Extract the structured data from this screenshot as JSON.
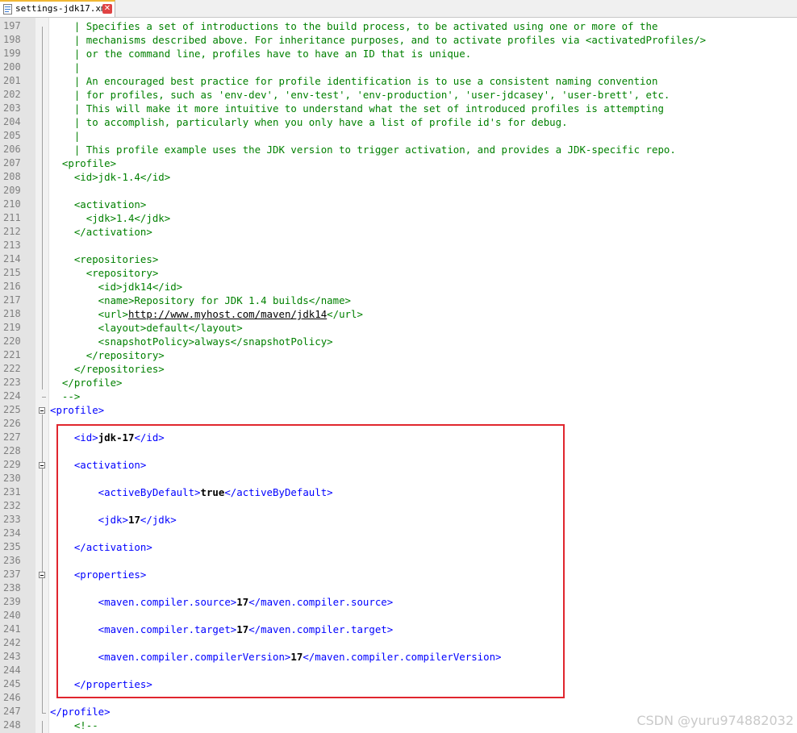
{
  "tab": {
    "label": "settings-jdk17.xml"
  },
  "watermark": "CSDN @yuru974882032",
  "colors": {
    "comment": "#008000",
    "tag": "#0000ff",
    "text": "#000000",
    "highlight": "#e0262e"
  },
  "lines": [
    {
      "n": "197",
      "segs": [
        [
          "c",
          "    | Specifies a set of introductions to the build process, to be activated using one or more of the"
        ]
      ]
    },
    {
      "n": "198",
      "segs": [
        [
          "c",
          "    | mechanisms described above. For inheritance purposes, and to activate profiles via <activatedProfiles/>"
        ]
      ]
    },
    {
      "n": "199",
      "segs": [
        [
          "c",
          "    | or the command line, profiles have to have an ID that is unique."
        ]
      ]
    },
    {
      "n": "200",
      "segs": [
        [
          "c",
          "    |"
        ]
      ]
    },
    {
      "n": "201",
      "segs": [
        [
          "c",
          "    | An encouraged best practice for profile identification is to use a consistent naming convention"
        ]
      ]
    },
    {
      "n": "202",
      "segs": [
        [
          "c",
          "    | for profiles, such as 'env-dev', 'env-test', 'env-production', 'user-jdcasey', 'user-brett', etc."
        ]
      ]
    },
    {
      "n": "203",
      "segs": [
        [
          "c",
          "    | This will make it more intuitive to understand what the set of introduced profiles is attempting"
        ]
      ]
    },
    {
      "n": "204",
      "segs": [
        [
          "c",
          "    | to accomplish, particularly when you only have a list of profile id's for debug."
        ]
      ]
    },
    {
      "n": "205",
      "segs": [
        [
          "c",
          "    |"
        ]
      ]
    },
    {
      "n": "206",
      "segs": [
        [
          "c",
          "    | This profile example uses the JDK version to trigger activation, and provides a JDK-specific repo."
        ]
      ]
    },
    {
      "n": "207",
      "segs": [
        [
          "c",
          "  <profile>"
        ]
      ]
    },
    {
      "n": "208",
      "segs": [
        [
          "c",
          "    <id>jdk-1.4</id>"
        ]
      ]
    },
    {
      "n": "209",
      "segs": [
        [
          "c",
          ""
        ]
      ]
    },
    {
      "n": "210",
      "segs": [
        [
          "c",
          "    <activation>"
        ]
      ]
    },
    {
      "n": "211",
      "segs": [
        [
          "c",
          "      <jdk>1.4</jdk>"
        ]
      ]
    },
    {
      "n": "212",
      "segs": [
        [
          "c",
          "    </activation>"
        ]
      ]
    },
    {
      "n": "213",
      "segs": [
        [
          "c",
          ""
        ]
      ]
    },
    {
      "n": "214",
      "segs": [
        [
          "c",
          "    <repositories>"
        ]
      ]
    },
    {
      "n": "215",
      "segs": [
        [
          "c",
          "      <repository>"
        ]
      ]
    },
    {
      "n": "216",
      "segs": [
        [
          "c",
          "        <id>jdk14</id>"
        ]
      ]
    },
    {
      "n": "217",
      "segs": [
        [
          "c",
          "        <name>Repository for JDK 1.4 builds</name>"
        ]
      ]
    },
    {
      "n": "218",
      "segs": [
        [
          "c",
          "        <url>"
        ],
        [
          "l",
          "http://www.myhost.com/maven/jdk14"
        ],
        [
          "c",
          "</url>"
        ]
      ]
    },
    {
      "n": "219",
      "segs": [
        [
          "c",
          "        <layout>default</layout>"
        ]
      ]
    },
    {
      "n": "220",
      "segs": [
        [
          "c",
          "        <snapshotPolicy>always</snapshotPolicy>"
        ]
      ]
    },
    {
      "n": "221",
      "segs": [
        [
          "c",
          "      </repository>"
        ]
      ]
    },
    {
      "n": "222",
      "segs": [
        [
          "c",
          "    </repositories>"
        ]
      ]
    },
    {
      "n": "223",
      "segs": [
        [
          "c",
          "  </profile>"
        ]
      ]
    },
    {
      "n": "224",
      "segs": [
        [
          "c",
          "  -->"
        ]
      ]
    },
    {
      "n": "225",
      "segs": [
        [
          "t",
          "<profile>"
        ]
      ]
    },
    {
      "n": "226",
      "segs": [
        [
          "t",
          ""
        ]
      ]
    },
    {
      "n": "227",
      "segs": [
        [
          "t",
          "    <id>"
        ],
        [
          "x",
          "jdk-17"
        ],
        [
          "t",
          "</id>"
        ]
      ]
    },
    {
      "n": "228",
      "segs": [
        [
          "t",
          ""
        ]
      ]
    },
    {
      "n": "229",
      "segs": [
        [
          "t",
          "    <activation>"
        ]
      ]
    },
    {
      "n": "230",
      "segs": [
        [
          "t",
          ""
        ]
      ]
    },
    {
      "n": "231",
      "segs": [
        [
          "t",
          "        <activeByDefault>"
        ],
        [
          "x",
          "true"
        ],
        [
          "t",
          "</activeByDefault>"
        ]
      ]
    },
    {
      "n": "232",
      "segs": [
        [
          "t",
          ""
        ]
      ]
    },
    {
      "n": "233",
      "segs": [
        [
          "t",
          "        <jdk>"
        ],
        [
          "x",
          "17"
        ],
        [
          "t",
          "</jdk>"
        ]
      ]
    },
    {
      "n": "234",
      "segs": [
        [
          "t",
          ""
        ]
      ]
    },
    {
      "n": "235",
      "segs": [
        [
          "t",
          "    </activation>"
        ]
      ]
    },
    {
      "n": "236",
      "segs": [
        [
          "t",
          ""
        ]
      ]
    },
    {
      "n": "237",
      "segs": [
        [
          "t",
          "    <properties>"
        ]
      ]
    },
    {
      "n": "238",
      "segs": [
        [
          "t",
          ""
        ]
      ]
    },
    {
      "n": "239",
      "segs": [
        [
          "t",
          "        <maven.compiler.source>"
        ],
        [
          "x",
          "17"
        ],
        [
          "t",
          "</maven.compiler.source>"
        ]
      ]
    },
    {
      "n": "240",
      "segs": [
        [
          "t",
          ""
        ]
      ]
    },
    {
      "n": "241",
      "segs": [
        [
          "t",
          "        <maven.compiler.target>"
        ],
        [
          "x",
          "17"
        ],
        [
          "t",
          "</maven.compiler.target>"
        ]
      ]
    },
    {
      "n": "242",
      "segs": [
        [
          "t",
          ""
        ]
      ]
    },
    {
      "n": "243",
      "segs": [
        [
          "t",
          "        <maven.compiler.compilerVersion>"
        ],
        [
          "x",
          "17"
        ],
        [
          "t",
          "</maven.compiler.compilerVersion>"
        ]
      ]
    },
    {
      "n": "244",
      "segs": [
        [
          "t",
          ""
        ]
      ]
    },
    {
      "n": "245",
      "segs": [
        [
          "t",
          "    </properties>"
        ]
      ]
    },
    {
      "n": "246",
      "segs": [
        [
          "t",
          ""
        ]
      ]
    },
    {
      "n": "247",
      "segs": [
        [
          "t",
          "</profile>"
        ]
      ]
    },
    {
      "n": "248",
      "segs": [
        [
          "c",
          "    <!--"
        ]
      ]
    }
  ]
}
